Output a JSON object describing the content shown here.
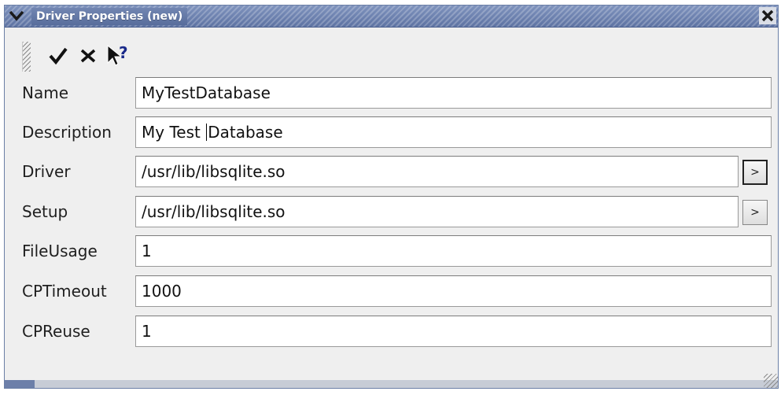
{
  "window": {
    "title": "Driver Properties (new)"
  },
  "toolbar": {
    "items": [
      {
        "icon": "checkmark-icon"
      },
      {
        "icon": "close-x-icon"
      },
      {
        "icon": "whats-this-help-icon"
      }
    ]
  },
  "form": {
    "name": {
      "label": "Name",
      "value": "MyTestDatabase"
    },
    "description": {
      "label": "Description",
      "value_before_cursor": "My Test ",
      "value_after_cursor": "Database"
    },
    "driver": {
      "label": "Driver",
      "value": "/usr/lib/libsqlite.so",
      "button_label": ">"
    },
    "setup": {
      "label": "Setup",
      "value": "/usr/lib/libsqlite.so",
      "button_label": ">"
    },
    "file_usage": {
      "label": "FileUsage",
      "value": "1"
    },
    "cp_timeout": {
      "label": "CPTimeout",
      "value": "1000"
    },
    "cp_reuse": {
      "label": "CPReuse",
      "value": "1"
    }
  },
  "colors": {
    "titlebar": "#6b7fa9",
    "window_bg": "#efefef",
    "field_bg": "#ffffff"
  }
}
